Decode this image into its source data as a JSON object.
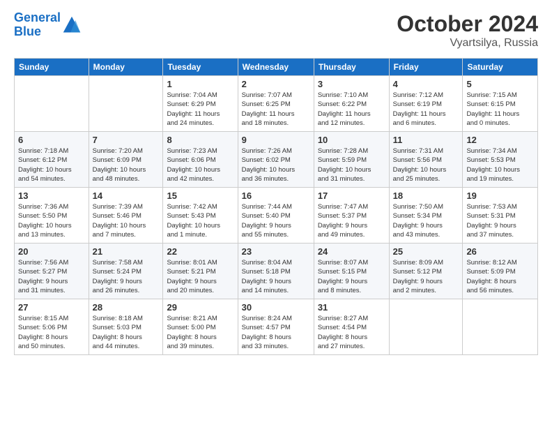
{
  "header": {
    "logo_line1": "General",
    "logo_line2": "Blue",
    "month": "October 2024",
    "location": "Vyartsilya, Russia"
  },
  "weekdays": [
    "Sunday",
    "Monday",
    "Tuesday",
    "Wednesday",
    "Thursday",
    "Friday",
    "Saturday"
  ],
  "weeks": [
    [
      {
        "day": "",
        "info": ""
      },
      {
        "day": "",
        "info": ""
      },
      {
        "day": "1",
        "info": "Sunrise: 7:04 AM\nSunset: 6:29 PM\nDaylight: 11 hours\nand 24 minutes."
      },
      {
        "day": "2",
        "info": "Sunrise: 7:07 AM\nSunset: 6:25 PM\nDaylight: 11 hours\nand 18 minutes."
      },
      {
        "day": "3",
        "info": "Sunrise: 7:10 AM\nSunset: 6:22 PM\nDaylight: 11 hours\nand 12 minutes."
      },
      {
        "day": "4",
        "info": "Sunrise: 7:12 AM\nSunset: 6:19 PM\nDaylight: 11 hours\nand 6 minutes."
      },
      {
        "day": "5",
        "info": "Sunrise: 7:15 AM\nSunset: 6:15 PM\nDaylight: 11 hours\nand 0 minutes."
      }
    ],
    [
      {
        "day": "6",
        "info": "Sunrise: 7:18 AM\nSunset: 6:12 PM\nDaylight: 10 hours\nand 54 minutes."
      },
      {
        "day": "7",
        "info": "Sunrise: 7:20 AM\nSunset: 6:09 PM\nDaylight: 10 hours\nand 48 minutes."
      },
      {
        "day": "8",
        "info": "Sunrise: 7:23 AM\nSunset: 6:06 PM\nDaylight: 10 hours\nand 42 minutes."
      },
      {
        "day": "9",
        "info": "Sunrise: 7:26 AM\nSunset: 6:02 PM\nDaylight: 10 hours\nand 36 minutes."
      },
      {
        "day": "10",
        "info": "Sunrise: 7:28 AM\nSunset: 5:59 PM\nDaylight: 10 hours\nand 31 minutes."
      },
      {
        "day": "11",
        "info": "Sunrise: 7:31 AM\nSunset: 5:56 PM\nDaylight: 10 hours\nand 25 minutes."
      },
      {
        "day": "12",
        "info": "Sunrise: 7:34 AM\nSunset: 5:53 PM\nDaylight: 10 hours\nand 19 minutes."
      }
    ],
    [
      {
        "day": "13",
        "info": "Sunrise: 7:36 AM\nSunset: 5:50 PM\nDaylight: 10 hours\nand 13 minutes."
      },
      {
        "day": "14",
        "info": "Sunrise: 7:39 AM\nSunset: 5:46 PM\nDaylight: 10 hours\nand 7 minutes."
      },
      {
        "day": "15",
        "info": "Sunrise: 7:42 AM\nSunset: 5:43 PM\nDaylight: 10 hours\nand 1 minute."
      },
      {
        "day": "16",
        "info": "Sunrise: 7:44 AM\nSunset: 5:40 PM\nDaylight: 9 hours\nand 55 minutes."
      },
      {
        "day": "17",
        "info": "Sunrise: 7:47 AM\nSunset: 5:37 PM\nDaylight: 9 hours\nand 49 minutes."
      },
      {
        "day": "18",
        "info": "Sunrise: 7:50 AM\nSunset: 5:34 PM\nDaylight: 9 hours\nand 43 minutes."
      },
      {
        "day": "19",
        "info": "Sunrise: 7:53 AM\nSunset: 5:31 PM\nDaylight: 9 hours\nand 37 minutes."
      }
    ],
    [
      {
        "day": "20",
        "info": "Sunrise: 7:56 AM\nSunset: 5:27 PM\nDaylight: 9 hours\nand 31 minutes."
      },
      {
        "day": "21",
        "info": "Sunrise: 7:58 AM\nSunset: 5:24 PM\nDaylight: 9 hours\nand 26 minutes."
      },
      {
        "day": "22",
        "info": "Sunrise: 8:01 AM\nSunset: 5:21 PM\nDaylight: 9 hours\nand 20 minutes."
      },
      {
        "day": "23",
        "info": "Sunrise: 8:04 AM\nSunset: 5:18 PM\nDaylight: 9 hours\nand 14 minutes."
      },
      {
        "day": "24",
        "info": "Sunrise: 8:07 AM\nSunset: 5:15 PM\nDaylight: 9 hours\nand 8 minutes."
      },
      {
        "day": "25",
        "info": "Sunrise: 8:09 AM\nSunset: 5:12 PM\nDaylight: 9 hours\nand 2 minutes."
      },
      {
        "day": "26",
        "info": "Sunrise: 8:12 AM\nSunset: 5:09 PM\nDaylight: 8 hours\nand 56 minutes."
      }
    ],
    [
      {
        "day": "27",
        "info": "Sunrise: 8:15 AM\nSunset: 5:06 PM\nDaylight: 8 hours\nand 50 minutes."
      },
      {
        "day": "28",
        "info": "Sunrise: 8:18 AM\nSunset: 5:03 PM\nDaylight: 8 hours\nand 44 minutes."
      },
      {
        "day": "29",
        "info": "Sunrise: 8:21 AM\nSunset: 5:00 PM\nDaylight: 8 hours\nand 39 minutes."
      },
      {
        "day": "30",
        "info": "Sunrise: 8:24 AM\nSunset: 4:57 PM\nDaylight: 8 hours\nand 33 minutes."
      },
      {
        "day": "31",
        "info": "Sunrise: 8:27 AM\nSunset: 4:54 PM\nDaylight: 8 hours\nand 27 minutes."
      },
      {
        "day": "",
        "info": ""
      },
      {
        "day": "",
        "info": ""
      }
    ]
  ]
}
